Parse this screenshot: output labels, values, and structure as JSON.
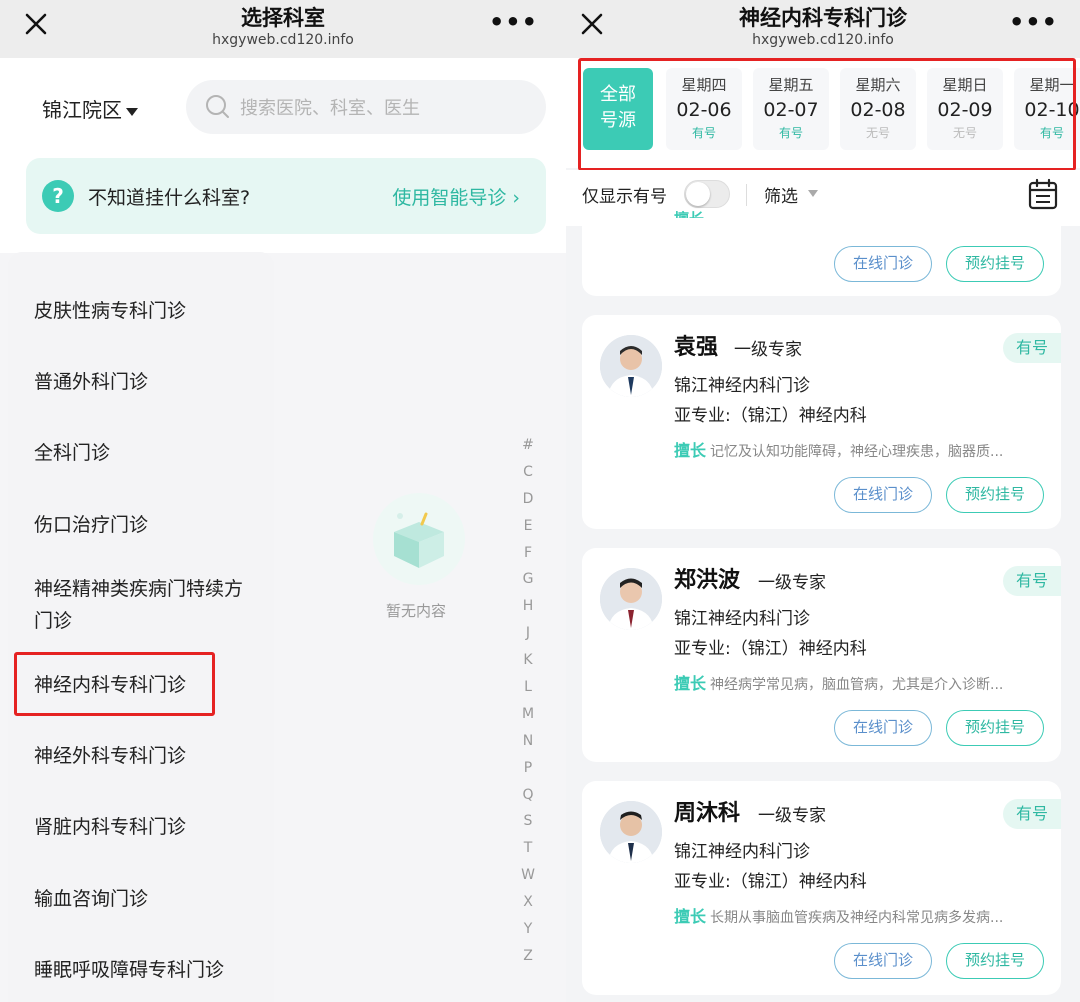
{
  "left": {
    "title": "选择科室",
    "url": "hxgyweb.cd120.info",
    "more": "•••",
    "campus": "锦江院区",
    "search_placeholder": "搜索医院、科室、医生",
    "guide_question": "不知道挂什么科室?",
    "guide_link": "使用智能导诊",
    "departments": [
      "皮肤性病专科门诊",
      "普通外科门诊",
      "全科门诊",
      "伤口治疗门诊",
      "神经精神类疾病门特续方",
      "门诊",
      "神经内科专科门诊",
      "神经外科专科门诊",
      "肾脏内科专科门诊",
      "输血咨询门诊",
      "睡眠呼吸障碍专科门诊"
    ],
    "empty_text": "暂无内容",
    "index_letters": [
      "#",
      "C",
      "D",
      "E",
      "F",
      "G",
      "H",
      "J",
      "K",
      "L",
      "M",
      "N",
      "P",
      "Q",
      "S",
      "T",
      "W",
      "X",
      "Y",
      "Z"
    ]
  },
  "right": {
    "title": "神经内科专科门诊",
    "url": "hxgyweb.cd120.info",
    "more": "•••",
    "all_label_1": "全部",
    "all_label_2": "号源",
    "dates": [
      {
        "weekday": "星期四",
        "date": "02-06",
        "status": "有号"
      },
      {
        "weekday": "星期五",
        "date": "02-07",
        "status": "有号"
      },
      {
        "weekday": "星期六",
        "date": "02-08",
        "status": "无号"
      },
      {
        "weekday": "星期日",
        "date": "02-09",
        "status": "无号"
      },
      {
        "weekday": "星期一",
        "date": "02-10",
        "status": "有号"
      }
    ],
    "only_available": "仅显示有号",
    "filter_label": "筛选",
    "btn_online": "在线门诊",
    "btn_book": "预约挂号",
    "partial_card_text": "擅长",
    "doctors": [
      {
        "name": "袁强",
        "level": "一级专家",
        "badge": "有号",
        "dept": "锦江神经内科门诊",
        "sub": "亚专业:（锦江）神经内科",
        "tag": "擅长",
        "specialty": "记忆及认知功能障碍，神经心理疾患，脑器质..."
      },
      {
        "name": "郑洪波",
        "level": "一级专家",
        "badge": "有号",
        "dept": "锦江神经内科门诊",
        "sub": "亚专业:（锦江）神经内科",
        "tag": "擅长",
        "specialty": "神经病学常见病，脑血管病，尤其是介入诊断..."
      },
      {
        "name": "周沐科",
        "level": "一级专家",
        "badge": "有号",
        "dept": "锦江神经内科门诊",
        "sub": "亚专业:（锦江）神经内科",
        "tag": "擅长",
        "specialty": "长期从事脑血管疾病及神经内科常见病多发病..."
      }
    ]
  },
  "colors": {
    "accent": "#3ccbb5",
    "highlight_box": "#e52222",
    "available": "#2fb8a2",
    "unavailable": "#bbbbbb"
  }
}
